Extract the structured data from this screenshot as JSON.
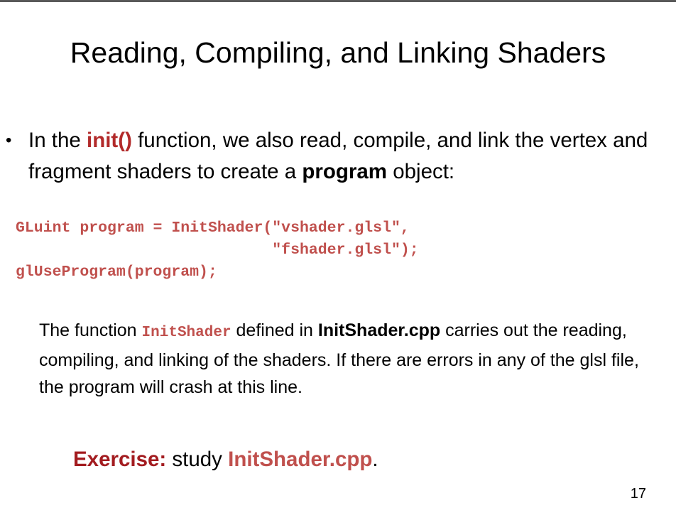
{
  "slide": {
    "title": "Reading, Compiling, and Linking Shaders",
    "bullet": {
      "marker": "•",
      "text_1": "In the ",
      "function_name": "init()",
      "text_2": " function, we also read, compile, and link the vertex and fragment shaders to create a ",
      "bold_word": "program",
      "text_3": " object:"
    },
    "code_lines": [
      "GLuint program = InitShader(\"vshader.glsl\",",
      "                            \"fshader.glsl\");",
      "glUseProgram(program);"
    ],
    "paragraph": {
      "text_1": "The function ",
      "code_name": "InitShader",
      "text_2": " defined in ",
      "file_name": "InitShader.cpp",
      "text_3": " carries out the reading, compiling, and linking of the shaders. If there are errors in any of the glsl file, the program will crash at this line."
    },
    "exercise": {
      "label": "Exercise:",
      "text": " study ",
      "file": "InitShader.cpp",
      "period": "."
    },
    "page_number": "17"
  },
  "colors": {
    "accent": "#b22a2a",
    "code": "#c0504d",
    "exercise_label": "#a31c20",
    "rule": "#595959"
  }
}
